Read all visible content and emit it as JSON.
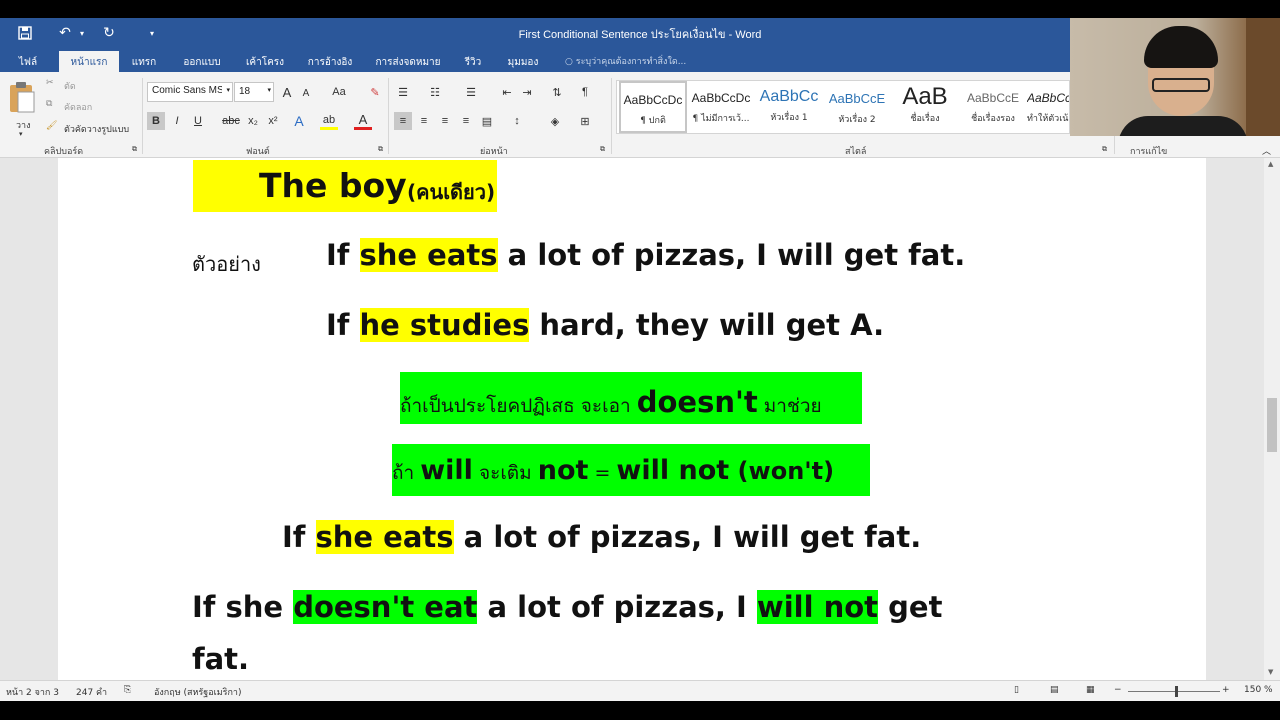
{
  "title_bar": {
    "title": "First Conditional Sentence ประโยคเงื่อนไข - Word",
    "save_icon": "save-icon",
    "undo_icon": "undo-icon",
    "redo_icon": "redo-icon",
    "customize_icon": "customize-quick-access-icon"
  },
  "tabs": [
    {
      "label": "ไฟล์"
    },
    {
      "label": "หน้าแรก"
    },
    {
      "label": "แทรก"
    },
    {
      "label": "ออกแบบ"
    },
    {
      "label": "เค้าโครง"
    },
    {
      "label": "การอ้างอิง"
    },
    {
      "label": "การส่งจดหมาย"
    },
    {
      "label": "รีวิว"
    },
    {
      "label": "มุมมอง"
    }
  ],
  "tell_me": "ระบุว่าคุณต้องการทำสิ่งใด...",
  "ribbon": {
    "clipboard": {
      "paste": "วาง",
      "cut": "ตัด",
      "copy": "คัดลอก",
      "format_painter": "ตัวคัดวางรูปแบบ",
      "label": "คลิปบอร์ด"
    },
    "font": {
      "font_name": "Comic Sans MS",
      "font_size": "18",
      "label": "ฟอนต์",
      "bold": "B",
      "italic": "I",
      "underline": "U",
      "strike": "abc",
      "subscript": "x₂",
      "superscript": "x²",
      "case": "Aa",
      "grow": "A",
      "shrink": "A",
      "text_effects": "A",
      "highlight": "ab",
      "font_color": "A"
    },
    "paragraph": {
      "label": "ย่อหน้า",
      "show_marks": "¶"
    },
    "styles": {
      "label": "สไตล์",
      "items": [
        {
          "preview": "AaBbCcDc",
          "name": "¶ ปกติ"
        },
        {
          "preview": "AaBbCcDc",
          "name": "¶ ไม่มีการเว้..."
        },
        {
          "preview": "AaBbCc",
          "name": "หัวเรื่อง 1"
        },
        {
          "preview": "AaBbCcE",
          "name": "หัวเรื่อง 2"
        },
        {
          "preview": "AaB",
          "name": "ชื่อเรื่อง"
        },
        {
          "preview": "AaBbCcE",
          "name": "ชื่อเรื่องรอง"
        },
        {
          "preview": "AaBbCcDc",
          "name": "ทำให้ตัวเน้น..."
        }
      ]
    },
    "editing": {
      "label": "การแก้ไข"
    }
  },
  "document": {
    "line1": {
      "main": "The boy",
      "thai": "(คนเดียว)"
    },
    "line2": {
      "prefix": "ตัวอย่าง",
      "t1": "If ",
      "hl": "she eats",
      "t2": " a lot of pizzas, I will get fat."
    },
    "line3": {
      "t1": "If ",
      "hl": "he studies",
      "t2": " hard, they will get A."
    },
    "line4": {
      "thai1": "ถ้าเป็นประโยคปฏิเสธ จะเอา ",
      "bold": "doesn't",
      "thai2": " มาช่วย"
    },
    "line5": {
      "thai1": "ถ้า ",
      "w1": "will",
      "thai2": "  จะเติม ",
      "w2": "not",
      "eq": " = ",
      "w3": "will not",
      "w4": " (won't)"
    },
    "line6": {
      "t1": "If ",
      "hl": "she eats",
      "t2": " a lot of pizzas, I will get fat."
    },
    "line7": {
      "t1": "If she ",
      "hl1": "doesn't eat",
      "t2": " a lot of pizzas, I ",
      "hl2": "will not",
      "t3": " get"
    },
    "line8": {
      "t1": "fat."
    }
  },
  "status": {
    "page": "หน้า 2 จาก 3",
    "words": "247 คำ",
    "language": "อังกฤษ (สหรัฐอเมริกา)",
    "zoom": "150 %"
  },
  "colors": {
    "ribbon_blue": "#2b579a",
    "highlight_yellow": "#ffff00",
    "highlight_green": "#00ff00"
  }
}
